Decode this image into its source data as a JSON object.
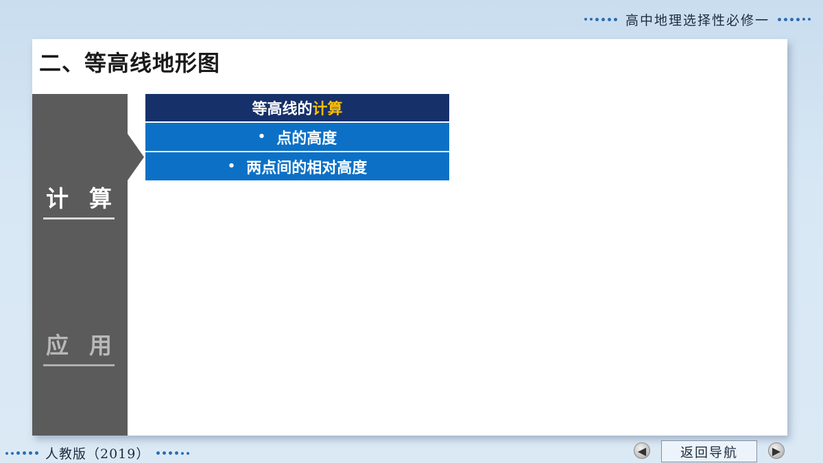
{
  "header": {
    "title": "高中地理选择性必修一"
  },
  "section": {
    "title": "二、等高线地形图"
  },
  "sidebar": {
    "items": [
      {
        "label": "计算",
        "active": true
      },
      {
        "label": "应用",
        "active": false
      }
    ]
  },
  "table": {
    "heading_prefix": "等高线的",
    "heading_highlight": "计算",
    "rows": [
      {
        "bullet": "•",
        "label": "点的高度"
      },
      {
        "bullet": "•",
        "label": "两点间的相对高度"
      }
    ]
  },
  "footer": {
    "edition": "人教版（2019）",
    "nav_prev_icon": "arrow-left",
    "nav_next_icon": "arrow-right",
    "nav_home_label": "返回导航"
  },
  "colors": {
    "heading_bg": "#16306a",
    "row_bg": "#0c71c6",
    "highlight": "#ffc000",
    "sidebar_bg": "#5b5b5b",
    "dots": "#2a6db3"
  }
}
